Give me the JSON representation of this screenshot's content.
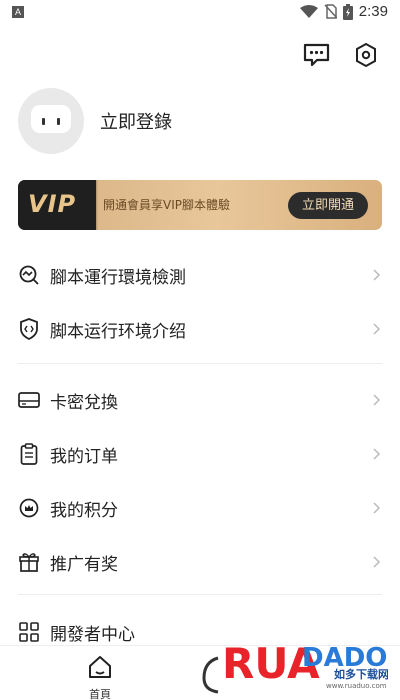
{
  "status_bar": {
    "app_indicator": "A",
    "time": "2:39",
    "icons": [
      "wifi-icon",
      "no-sim-icon",
      "battery-charging-icon"
    ]
  },
  "header": {
    "icons": [
      "message-icon",
      "settings-hexagon-icon"
    ]
  },
  "profile": {
    "login_label": "立即登錄"
  },
  "vip": {
    "badge": "VIP",
    "promo_text": "開通會員享VIP腳本體驗",
    "button_label": "立即開通",
    "colors": {
      "dark": "#1f1f1f",
      "gold": "#e8c79b",
      "button": "#2c2c2c"
    }
  },
  "menu_group_1": [
    {
      "label": "腳本運行環境檢測",
      "icon": "wave-search-icon"
    },
    {
      "label": "脚本运行环境介绍",
      "icon": "shield-code-icon"
    }
  ],
  "menu_group_2": [
    {
      "label": "卡密兌換",
      "icon": "card-icon"
    },
    {
      "label": "我的订单",
      "icon": "clipboard-icon"
    },
    {
      "label": "我的积分",
      "icon": "crown-coin-icon"
    },
    {
      "label": "推广有奖",
      "icon": "gift-icon"
    }
  ],
  "menu_group_3": [
    {
      "label": "開發者中心",
      "icon": "grid-apps-icon"
    }
  ],
  "bottom_nav": {
    "home_label": "首頁"
  },
  "watermark": {
    "logo_text": "RUADADO",
    "site_name": "如多下载网",
    "url": "www.ruaduo.com"
  }
}
